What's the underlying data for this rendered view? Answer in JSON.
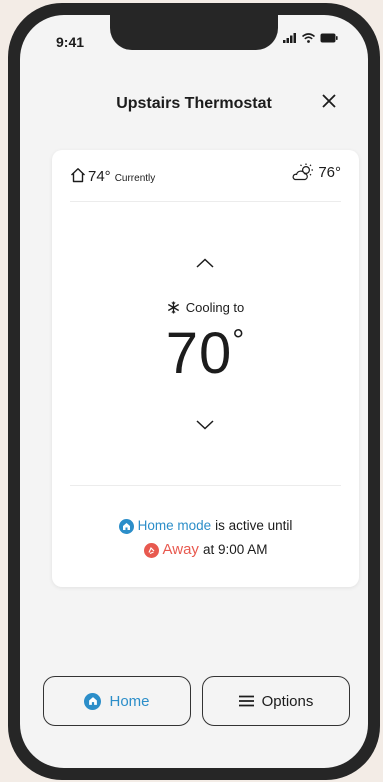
{
  "status_bar": {
    "time": "9:41"
  },
  "header": {
    "title": "Upstairs Thermostat"
  },
  "card": {
    "current_temp": "74°",
    "current_label": "Currently",
    "outdoor_temp": "76°",
    "mode_label": "Cooling to",
    "setpoint": "70",
    "setpoint_degree": "°",
    "status": {
      "home_mode": "Home mode",
      "active_until": "is active until",
      "away": "Away",
      "at_time": "at 9:00 AM"
    }
  },
  "bottom": {
    "home_label": "Home",
    "options_label": "Options"
  },
  "colors": {
    "home_blue": "#2c8ec9",
    "away_coral": "#e8594f"
  }
}
